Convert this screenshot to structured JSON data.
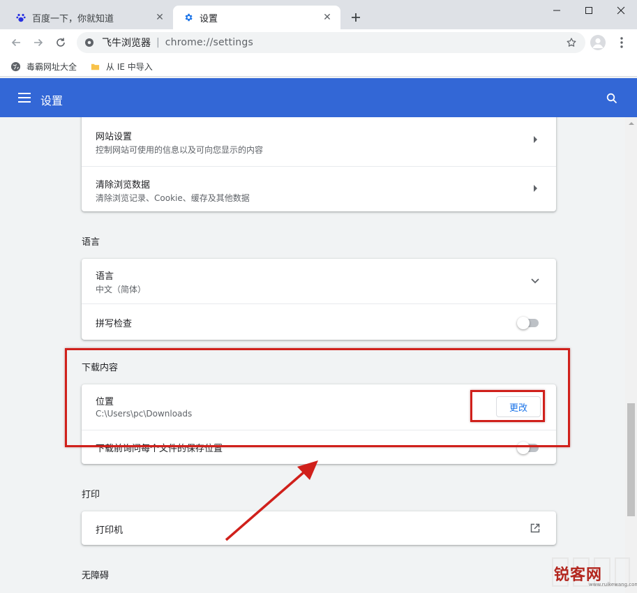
{
  "browser": {
    "tabs": [
      {
        "title": "百度一下，你就知道",
        "icon": "baidu-paw-icon",
        "active": false
      },
      {
        "title": "设置",
        "icon": "gear-icon",
        "active": true
      }
    ],
    "close_glyph": "✕",
    "omnibox": {
      "site_name": "飞牛浏览器",
      "separator": "|",
      "url": "chrome://settings"
    },
    "bookmarks": [
      {
        "label": "毒霸网址大全",
        "icon": "globe-icon"
      },
      {
        "label": "从 IE 中导入",
        "icon": "folder-icon"
      }
    ]
  },
  "settings": {
    "header_title": "设置",
    "privacy_rows": [
      {
        "title": "网站设置",
        "subtitle": "控制网站可使用的信息以及可向您显示的内容"
      },
      {
        "title": "清除浏览数据",
        "subtitle": "清除浏览记录、Cookie、缓存及其他数据"
      }
    ],
    "language": {
      "section_title": "语言",
      "language_row": {
        "title": "语言",
        "subtitle": "中文（简体）"
      },
      "spellcheck_row": {
        "title": "拼写检查",
        "enabled": false
      }
    },
    "downloads": {
      "section_title": "下载内容",
      "location_row": {
        "title": "位置",
        "subtitle": "C:\\Users\\pc\\Downloads",
        "button_label": "更改"
      },
      "ask_row": {
        "title": "下载前询问每个文件的保存位置",
        "enabled": false
      }
    },
    "printing": {
      "section_title": "打印",
      "printer_row": {
        "title": "打印机"
      }
    },
    "accessibility": {
      "section_title": "无障碍"
    }
  },
  "watermark": {
    "text": "锐客网",
    "url": "www.ruikewang.com"
  },
  "colors": {
    "header_blue": "#3367d6",
    "accent_blue": "#1a73e8",
    "annotation_red": "#d0201b",
    "page_bg": "#f1f3f4"
  }
}
